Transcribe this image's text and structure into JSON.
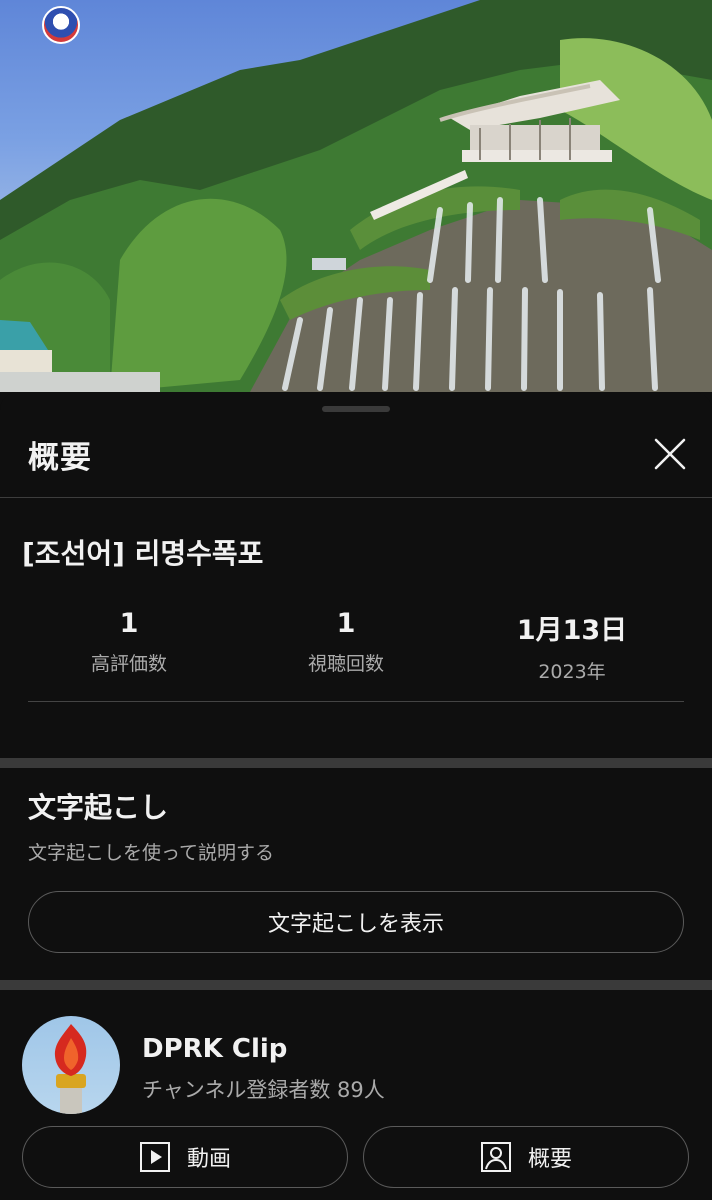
{
  "sheet": {
    "title": "概要"
  },
  "video": {
    "title": "[조선어] 리명수폭포"
  },
  "stats": [
    {
      "value": "1",
      "label": "高評価数"
    },
    {
      "value": "1",
      "label": "視聴回数"
    },
    {
      "value": "1月13日",
      "label": "2023年"
    }
  ],
  "transcript": {
    "title": "文字起こし",
    "subtitle": "文字起こしを使って説明する",
    "button_label": "文字起こしを表示"
  },
  "channel": {
    "name": "DPRK Clip",
    "subscribers": "チャンネル登録者数 89人",
    "videos_button": "動画",
    "about_button": "概要"
  },
  "icons": {
    "close": "close-icon",
    "videos": "play-box-icon",
    "about": "person-box-icon"
  }
}
